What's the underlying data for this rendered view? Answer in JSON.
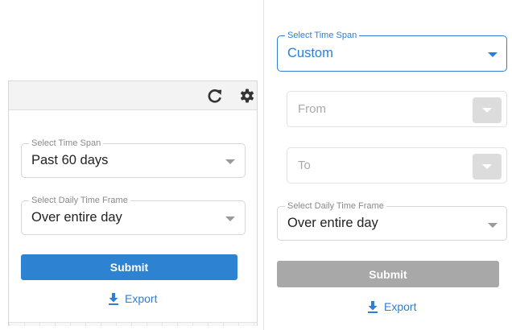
{
  "left_panel": {
    "toolbar": {
      "refresh_icon": "refresh-icon",
      "settings_icon": "gear-icon"
    },
    "time_span": {
      "label": "Select Time Span",
      "value": "Past 60 days"
    },
    "daily_time_frame": {
      "label": "Select Daily Time Frame",
      "value": "Over entire day"
    },
    "submit_label": "Submit",
    "export_label": "Export"
  },
  "right_panel": {
    "time_span": {
      "label": "Select Time Span",
      "value": "Custom"
    },
    "from": {
      "placeholder": "From"
    },
    "to": {
      "placeholder": "To"
    },
    "daily_time_frame": {
      "label": "Select Daily Time Frame",
      "value": "Over entire day"
    },
    "submit_label": "Submit",
    "export_label": "Export"
  },
  "colors": {
    "accent": "#2e7ed6",
    "submit_enabled": "#2e82d2",
    "submit_disabled": "#a8a8a8",
    "date_button_disabled": "#dcdcdc"
  }
}
